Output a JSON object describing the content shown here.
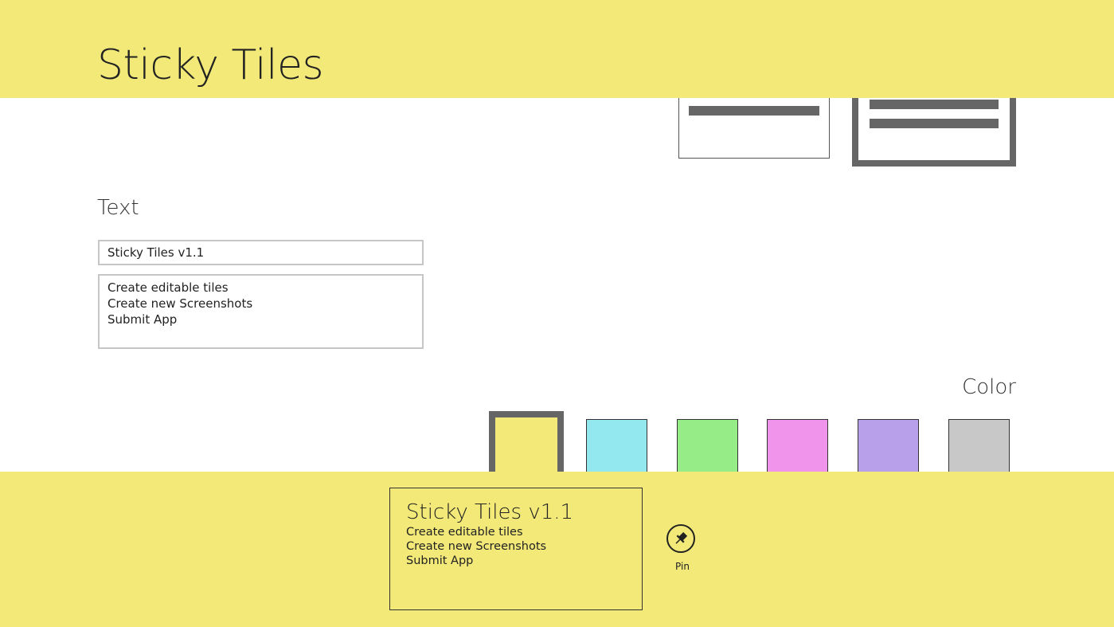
{
  "header": {
    "title": "Sticky Tiles"
  },
  "sections": {
    "text_label": "Text",
    "color_label": "Color"
  },
  "form": {
    "title_value": "Sticky Tiles v1.1",
    "body_value": "Create editable tiles\nCreate new Screenshots\nSubmit App"
  },
  "colors": {
    "yellow": "#f2e978",
    "cyan": "#93e7ef",
    "green": "#96ed88",
    "pink": "#f093eb",
    "purple": "#b8a0ea",
    "gray": "#c8c8c8",
    "selected_border": "#666666",
    "input_border": "#c6c6c6"
  },
  "swatches": [
    {
      "name": "yellow",
      "selected": true
    },
    {
      "name": "cyan",
      "selected": false
    },
    {
      "name": "green",
      "selected": false
    },
    {
      "name": "pink",
      "selected": false
    },
    {
      "name": "purple",
      "selected": false
    },
    {
      "name": "gray",
      "selected": false
    }
  ],
  "layout_options": [
    {
      "name": "small",
      "selected": false,
      "icon": "text-lines-icon"
    },
    {
      "name": "large",
      "selected": true,
      "icon": "text-lines-icon"
    }
  ],
  "preview": {
    "title": "Sticky Tiles v1.1",
    "lines": [
      "Create editable tiles",
      "Create new Screenshots",
      "Submit App"
    ]
  },
  "appbar": {
    "pin_label": "Pin",
    "pin_icon": "pin-icon"
  }
}
